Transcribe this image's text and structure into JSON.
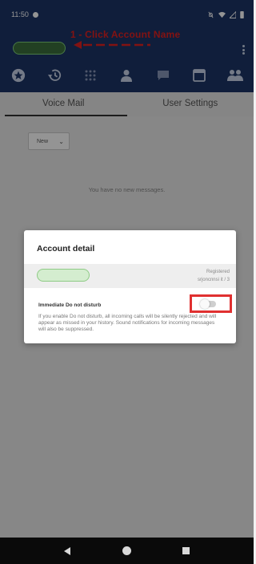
{
  "status_bar": {
    "time": "11:50"
  },
  "annotation": {
    "text": "1 - Click Account Name"
  },
  "tabs": [
    {
      "label": "Voice Mail"
    },
    {
      "label": "User Settings"
    }
  ],
  "voicemail": {
    "filter_value": "New",
    "empty_text": "You have no new messages."
  },
  "dialog": {
    "title": "Account detail",
    "status_line1": "Registered",
    "status_line2": "srjoncnnsi it / 3",
    "dnd_label": "Immediate Do not disturb",
    "dnd_description": "If you enable Do not disturb, all incoming calls will be silently rejected and will appear as missed in your history. Sound notifications for incoming messages will also be suppressed.",
    "dnd_enabled": false
  },
  "colors": {
    "header": "#1c3566",
    "annotation": "#e02020",
    "account_pill": "#8fcb86"
  },
  "icons": [
    "star-icon",
    "history-icon",
    "dialpad-icon",
    "contact-icon",
    "chat-icon",
    "window-icon",
    "group-icon"
  ]
}
